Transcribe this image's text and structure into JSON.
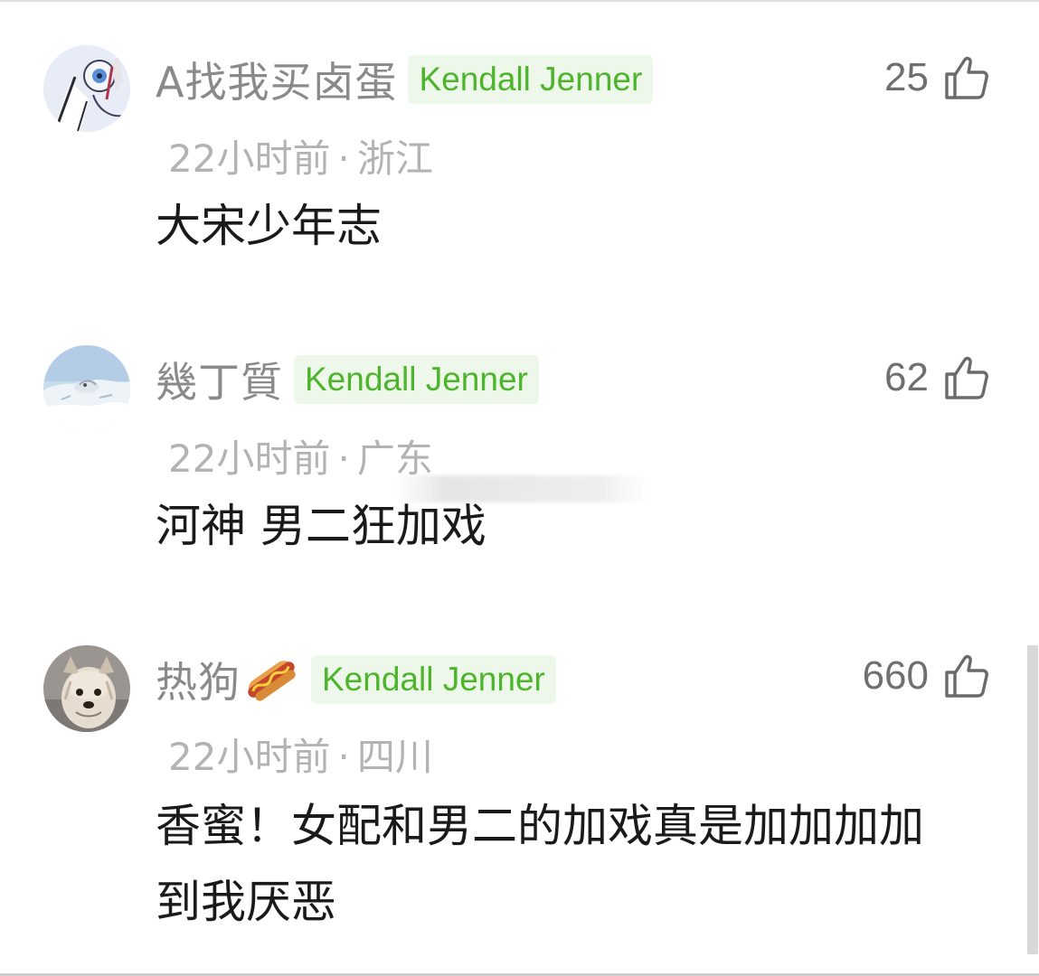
{
  "comments": [
    {
      "username": "A找我买卤蛋",
      "badge": "Kendall Jenner",
      "likes": "25",
      "time": "22小时前",
      "separator": "·",
      "location": "浙江",
      "text": "大宋少年志",
      "avatar_icon": "avatar-eye-illustration"
    },
    {
      "username": "幾丁質",
      "badge": "Kendall Jenner",
      "likes": "62",
      "time": "22小时前",
      "separator": "·",
      "location": "广东",
      "text": "河神 男二狂加戏",
      "avatar_icon": "avatar-snowy-landscape"
    },
    {
      "username": "热狗",
      "emoji": "hotdog-emoji",
      "badge": "Kendall Jenner",
      "likes": "660",
      "time": "22小时前",
      "separator": "·",
      "location": "四川",
      "text": "香蜜！女配和男二的加戏真是加加加加到我厌恶",
      "avatar_icon": "avatar-dog-photo"
    }
  ],
  "colors": {
    "username": "#8a8a8a",
    "badge_text": "#4cb52c",
    "badge_bg": "#eef8ea",
    "meta": "#b3b3b3",
    "text": "#1a1a1a",
    "likes": "#6f6f6f"
  },
  "icons": {
    "like": "thumbs-up-icon"
  }
}
